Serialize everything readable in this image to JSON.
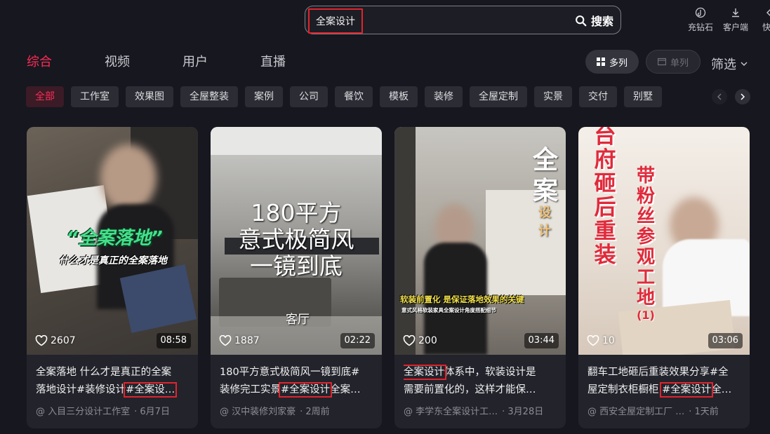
{
  "header": {
    "search_query": "全案设计",
    "search_button": "搜索",
    "actions": [
      {
        "label": "充钻石",
        "icon": "diamond-icon"
      },
      {
        "label": "客户端",
        "icon": "download-icon"
      },
      {
        "label": "快捷",
        "icon": "shortcut-icon"
      }
    ]
  },
  "tabs": [
    "综合",
    "视频",
    "用户",
    "直播"
  ],
  "active_tab": "综合",
  "view": {
    "multi": "多列",
    "single": "单列"
  },
  "filter_label": "筛选",
  "chips": [
    "全部",
    "工作室",
    "效果图",
    "全屋整装",
    "案例",
    "公司",
    "餐饮",
    "模板",
    "装修",
    "全屋定制",
    "实景",
    "交付",
    "别墅"
  ],
  "accent": "#fe2c55",
  "cards": [
    {
      "overlay_lines": [
        "“全案落地”",
        "什么才是真正的全案落地"
      ],
      "likes": "2607",
      "duration": "08:58",
      "caption_line1": "全案落地 什么才是真正的全案",
      "caption_line2_pre": "落地设计#装修设计",
      "caption_hl": "#全案设…",
      "caption_line2_post": "",
      "author": "@ 入目三分设计工作室",
      "date": "· 6月7日"
    },
    {
      "overlay_lines": [
        "180平方",
        "意式极简风",
        "一镜到底",
        "客厅"
      ],
      "likes": "1887",
      "duration": "02:22",
      "caption_line1": "180平方意式极简风一镜到底#",
      "caption_line2_pre": "装修完工实景",
      "caption_hl": "#全案设计",
      "caption_line2_post": "全案…",
      "author": "@ 汉中装修刘家豪",
      "date": "· 2周前"
    },
    {
      "overlay_lines": [
        "全",
        "案",
        "设计",
        "软装前置化 是保证落地效果的关键",
        "意式风格软装家具全案设计角度搭配细节"
      ],
      "likes": "200",
      "duration": "03:44",
      "caption_hl_first": "全案设计",
      "caption_line1_post": "体系中，软装设计是",
      "caption_line2": "需要前置化的，这样才能保…",
      "author": "@ 李学东全案设计工…",
      "date": "· 3月28日"
    },
    {
      "overlay_lines": [
        "台",
        "府",
        "砸",
        "后",
        "重",
        "装",
        "带",
        "粉",
        "丝",
        "参",
        "观",
        "工",
        "地",
        "(1)"
      ],
      "likes": "10",
      "duration": "03:06",
      "caption_line1": "翻车工地砸后重装效果分享#全",
      "caption_line2_pre": "屋定制衣柜橱柜 ",
      "caption_hl": "#全案设计",
      "caption_line2_post": "全…",
      "author": "@ 西安全屋定制工厂 …",
      "date": "· 1天前"
    }
  ]
}
